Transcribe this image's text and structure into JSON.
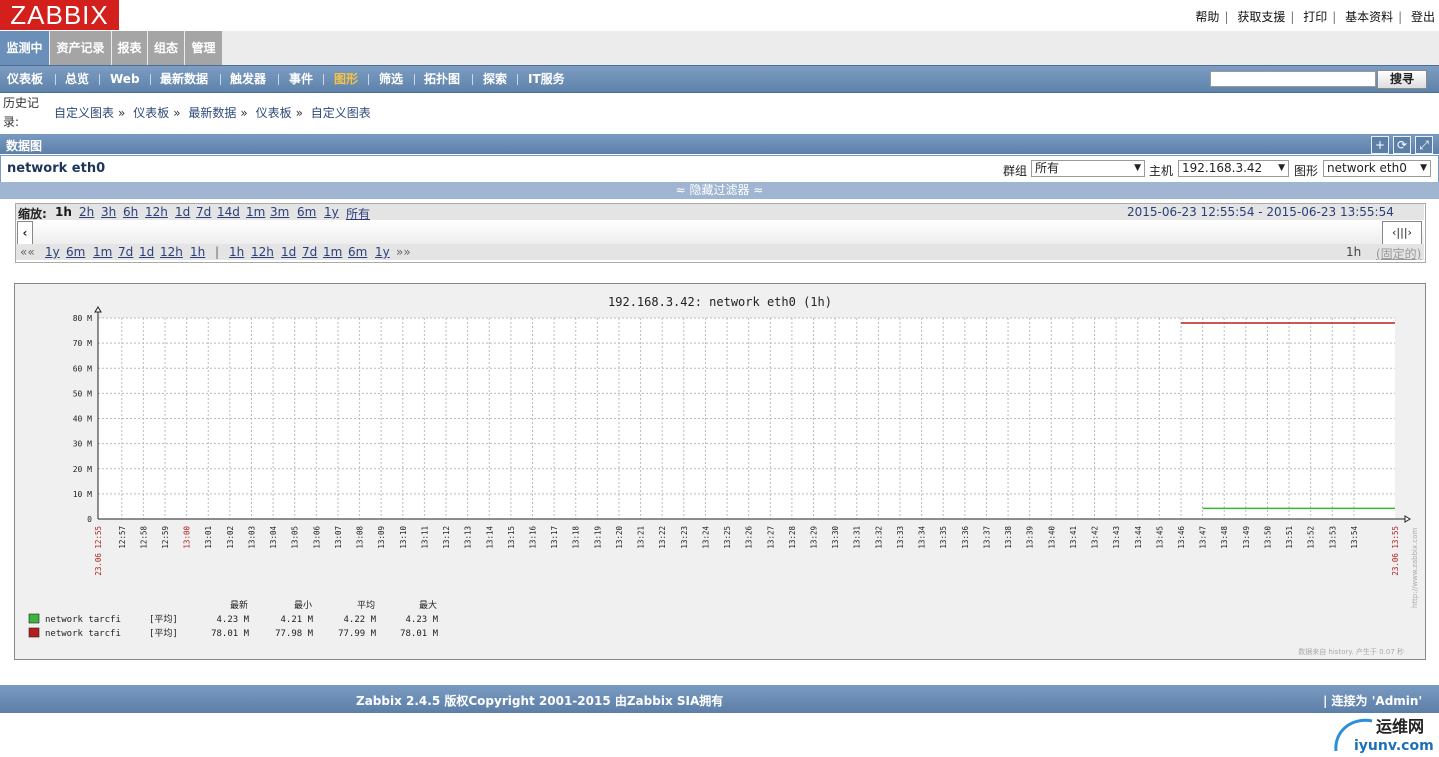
{
  "header": {
    "logo": "ZABBIX",
    "links": [
      "帮助",
      "获取支援",
      "打印",
      "基本资料",
      "登出"
    ]
  },
  "main_tabs": [
    "监测中",
    "资产记录",
    "报表",
    "组态",
    "管理"
  ],
  "sub_nav": {
    "items": [
      "仪表板",
      "总览",
      "Web",
      "最新数据",
      "触发器",
      "事件",
      "图形",
      "筛选",
      "拓扑图",
      "探索",
      "IT服务"
    ],
    "active": "图形",
    "search_button": "搜寻",
    "search_value": ""
  },
  "history": {
    "label": "历史记录:",
    "crumbs": [
      "自定义图表",
      "仪表板",
      "最新数据",
      "仪表板",
      "自定义图表"
    ],
    "separator": "»"
  },
  "section": {
    "title": "数据图",
    "buttons_icons": [
      "plus-icon",
      "refresh-icon",
      "fullscreen-icon"
    ]
  },
  "filter": {
    "graph_name": "network eth0",
    "group_label": "群组",
    "group_value": "所有",
    "host_label": "主机",
    "host_value": "192.168.3.42",
    "graph_label": "图形",
    "graph_value": "network eth0"
  },
  "toggle_filter": "≈ 隐藏过滤器 ≈",
  "zoom": {
    "label": "缩放:",
    "options": [
      "1h",
      "2h",
      "3h",
      "6h",
      "12h",
      "1d",
      "7d",
      "14d",
      "1m",
      "3m",
      "6m",
      "1y",
      "所有"
    ],
    "current": "1h",
    "range": "2015-06-23 12:55:54  -  2015-06-23 13:55:54"
  },
  "nav": {
    "back": [
      "«« ",
      "1y",
      "6m",
      "1m",
      "7d",
      "1d",
      "12h",
      "1h"
    ],
    "divider": "|",
    "forward": [
      "1h",
      "12h",
      "1d",
      "7d",
      "1m",
      "6m",
      "1y",
      " »»"
    ],
    "period": "1h",
    "fixed": "(固定的)"
  },
  "chart_data": {
    "type": "line",
    "title": "192.168.3.42: network eth0 (1h)",
    "y_ticks": [
      "0",
      "10 M",
      "20 M",
      "30 M",
      "40 M",
      "50 M",
      "60 M",
      "70 M",
      "80 M"
    ],
    "ylim": [
      0,
      80
    ],
    "x_start_label": "23.06 12:55",
    "x_end_label": "23.06 13:55",
    "x_ticks": [
      "12:57",
      "12:58",
      "12:59",
      "13:00",
      "13:01",
      "13:02",
      "13:03",
      "13:04",
      "13:05",
      "13:06",
      "13:07",
      "13:08",
      "13:09",
      "13:10",
      "13:11",
      "13:12",
      "13:13",
      "13:14",
      "13:15",
      "13:16",
      "13:17",
      "13:18",
      "13:19",
      "13:20",
      "13:21",
      "13:22",
      "13:23",
      "13:24",
      "13:25",
      "13:26",
      "13:27",
      "13:28",
      "13:29",
      "13:30",
      "13:31",
      "13:32",
      "13:33",
      "13:34",
      "13:35",
      "13:36",
      "13:37",
      "13:38",
      "13:39",
      "13:40",
      "13:41",
      "13:42",
      "13:43",
      "13:44",
      "13:45",
      "13:46",
      "13:47",
      "13:48",
      "13:49",
      "13:50",
      "13:51",
      "13:52",
      "13:53",
      "13:54"
    ],
    "grid": true,
    "series": [
      {
        "name": "network tarcfi",
        "color": "#3cb33c",
        "x_start": "13:47",
        "x_end": "13:55",
        "value": 4.23
      },
      {
        "name": "network tarcfi",
        "color": "#b32020",
        "x_start": "13:46",
        "x_end": "13:55",
        "value": 78.01
      }
    ],
    "legend": {
      "headers": [
        "最新",
        "最小",
        "平均",
        "最大"
      ],
      "rows": [
        {
          "name": "network tarcfi",
          "func": "[平均]",
          "last": "4.23 M",
          "min": "4.21 M",
          "avg": "4.22 M",
          "max": "4.23 M",
          "color": "#3cb33c"
        },
        {
          "name": "network tarcfi",
          "func": "[平均]",
          "last": "78.01 M",
          "min": "77.98 M",
          "avg": "77.99 M",
          "max": "78.01 M",
          "color": "#b32020"
        }
      ]
    },
    "side_text": "http://www.zabbix.com",
    "footer_note": "数据来自 history. 产生于 0.07 秒"
  },
  "footer": {
    "text": "Zabbix 2.4.5 版权Copyright 2001-2015 由Zabbix SIA拥有",
    "user": "|   连接为 'Admin'"
  },
  "watermark": {
    "line1": "运维网",
    "line2": "iyunv.com"
  }
}
